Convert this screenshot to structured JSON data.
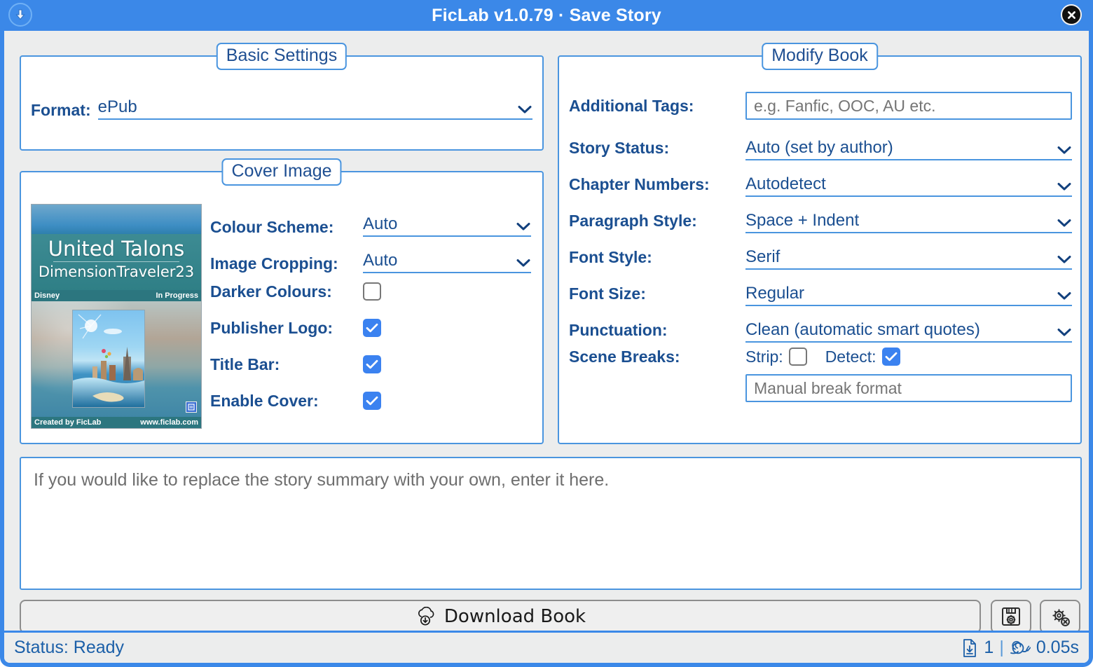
{
  "window": {
    "title": "FicLab v1.0.79 · Save Story",
    "app_icon": "download-circle-icon",
    "close_icon": "close-circle-icon",
    "accent_color": "#3b88e8",
    "label_color": "#1b4f91",
    "panel_bg": "#ffffff",
    "window_bg": "#eceded"
  },
  "basic_settings": {
    "legend": "Basic Settings",
    "format_label": "Format:",
    "format_value": "ePub"
  },
  "cover_image": {
    "legend": "Cover Image",
    "preview": {
      "title": "United Talons",
      "author": "DimensionTraveler23",
      "fandom": "Disney",
      "status": "In Progress",
      "credit": "Created by FicLab",
      "website": "www.ficlab.com",
      "logo": "ficlab-logo-icon"
    },
    "rows": [
      {
        "label": "Colour Scheme:",
        "type": "combo",
        "value": "Auto"
      },
      {
        "label": "Image Cropping:",
        "type": "combo",
        "value": "Auto"
      },
      {
        "label": "Darker Colours:",
        "type": "checkbox",
        "checked": false
      },
      {
        "label": "Publisher Logo:",
        "type": "checkbox",
        "checked": true
      },
      {
        "label": "Title Bar:",
        "type": "checkbox",
        "checked": true
      },
      {
        "label": "Enable Cover:",
        "type": "checkbox",
        "checked": true
      }
    ]
  },
  "modify_book": {
    "legend": "Modify Book",
    "additional_tags_label": "Additional Tags:",
    "additional_tags_value": "",
    "additional_tags_placeholder": "e.g. Fanfic, OOC, AU etc.",
    "story_status_label": "Story Status:",
    "story_status_value": "Auto (set by author)",
    "chapter_numbers_label": "Chapter Numbers:",
    "chapter_numbers_value": "Autodetect",
    "paragraph_style_label": "Paragraph Style:",
    "paragraph_style_value": "Space + Indent",
    "font_style_label": "Font Style:",
    "font_style_value": "Serif",
    "font_size_label": "Font Size:",
    "font_size_value": "Regular",
    "punctuation_label": "Punctuation:",
    "punctuation_value": "Clean (automatic smart quotes)",
    "scene_breaks_label": "Scene Breaks:",
    "scene_breaks_strip_label": "Strip:",
    "scene_breaks_strip_checked": false,
    "scene_breaks_detect_label": "Detect:",
    "scene_breaks_detect_checked": true,
    "manual_break_value": "",
    "manual_break_placeholder": "Manual break format"
  },
  "summary": {
    "value": "",
    "placeholder": "If you would like to replace the story summary with your own, enter it here."
  },
  "actions": {
    "download_label": "Download Book",
    "download_icon": "cloud-download-icon",
    "save_settings_icon": "floppy-gear-icon",
    "reset_settings_icon": "gear-x-icon"
  },
  "status_bar": {
    "status_text": "Status: Ready",
    "file_count": "1",
    "separator": "|",
    "elapsed_time": "0.05s",
    "file_icon": "file-download-icon",
    "speed_icon": "snail-icon"
  }
}
